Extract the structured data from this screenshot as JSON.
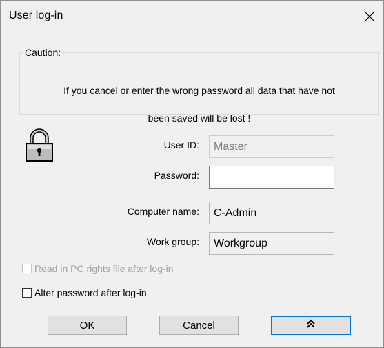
{
  "window": {
    "title": "User log-in"
  },
  "caution": {
    "legend": "Caution:",
    "message_line1": "If you cancel or enter the wrong password all data that have not",
    "message_line2": "been saved will be lost !"
  },
  "form": {
    "user_id_label": "User ID:",
    "user_id_value": "Master",
    "password_label": "Password:",
    "password_value": "",
    "computer_name_label": "Computer name:",
    "computer_name_value": "C-Admin",
    "work_group_label": "Work group:",
    "work_group_value": "Workgroup"
  },
  "options": {
    "read_rights_label": "Read in PC rights file after log-in",
    "read_rights_checked": false,
    "read_rights_enabled": false,
    "alter_password_label": "Alter password after log-in",
    "alter_password_checked": false
  },
  "buttons": {
    "ok_label": "OK",
    "cancel_label": "Cancel",
    "expand_icon": "double-chevron-up-icon"
  },
  "colors": {
    "focus_border": "#0078d7",
    "window_bg": "#f0f0f0"
  }
}
